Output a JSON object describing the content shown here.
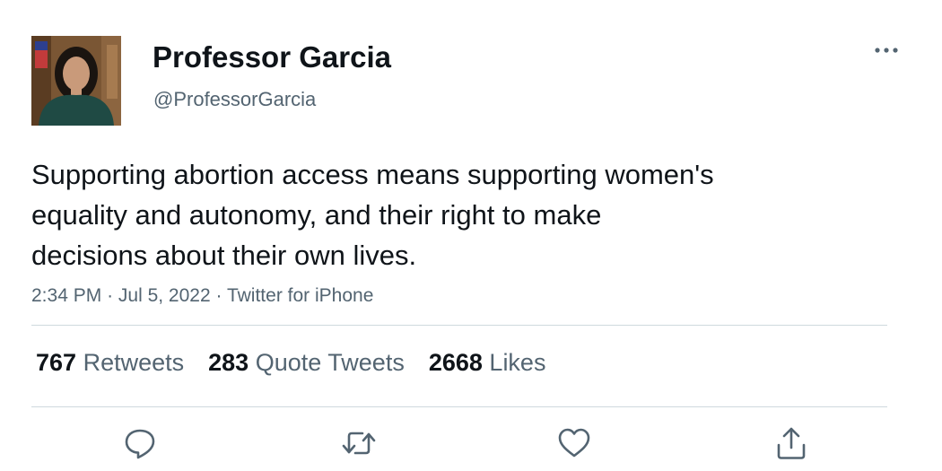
{
  "author": {
    "display_name": "Professor Garcia",
    "handle": "@ProfessorGarcia"
  },
  "tweet": {
    "text_lines": [
      "Supporting abortion access means supporting women's",
      "equality and autonomy, and their right to make",
      "decisions about their own lives."
    ],
    "time": "2:34 PM",
    "separator": "·",
    "date": "Jul 5, 2022",
    "source": "Twitter for iPhone"
  },
  "stats": {
    "retweets": {
      "count": "767",
      "label": "Retweets"
    },
    "quote_tweets": {
      "count": "283",
      "label": "Quote Tweets"
    },
    "likes": {
      "count": "2668",
      "label": "Likes"
    }
  },
  "icons": {
    "more": "more-horizontal-icon",
    "reply": "reply-icon",
    "retweet": "retweet-icon",
    "like": "heart-icon",
    "share": "share-icon"
  },
  "colors": {
    "text_primary": "#0f1419",
    "text_secondary": "#536471",
    "divider": "#cfd9de",
    "icon": "#536471"
  }
}
